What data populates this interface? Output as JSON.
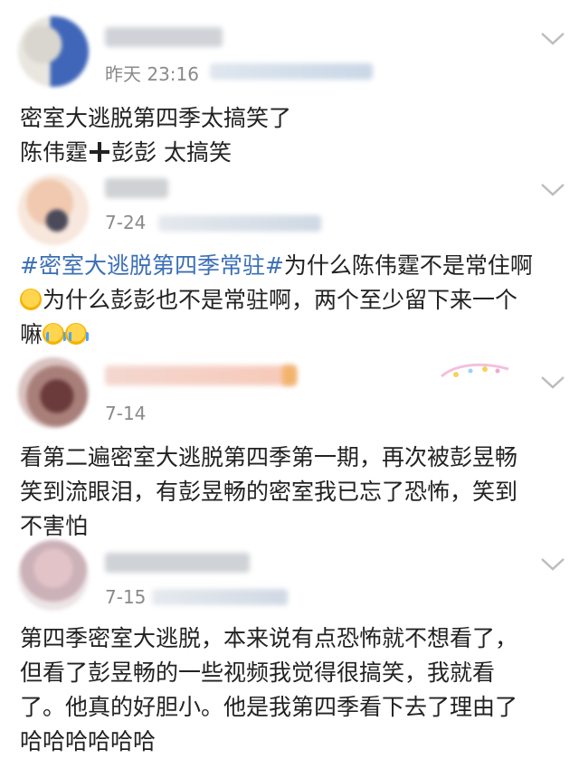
{
  "posts": [
    {
      "time": "昨天 23:16",
      "lines": [
        "密室大逃脱第四季太搞笑了"
      ],
      "line2_left": "陈伟霆",
      "line2_right": "彭彭 太搞笑"
    },
    {
      "time": "7-24",
      "topic": "#密室大逃脱第四季常驻#",
      "text_after_topic": "为什么陈伟霆不是常住啊",
      "line2": "为什么彭彭也不是常驻啊，两个至少留下来一个",
      "line3": "嘛"
    },
    {
      "time": "7-14",
      "lines": [
        "看第二遍密室大逃脱第四季第一期，再次被彭昱畅",
        "笑到流眼泪，有彭昱畅的密室我已忘了恐怖，笑到",
        "不害怕"
      ]
    },
    {
      "time": "7-15",
      "lines": [
        "第四季密室大逃脱，本来说有点恐怖就不想看了，",
        "但看了彭昱畅的一些视频我觉得很搞笑，我就看",
        "了。他真的好胆小。他是我第四季看下去了理由了",
        "哈哈哈哈哈哈"
      ]
    }
  ],
  "icons": {
    "expand": "chevron-down-icon",
    "emoji_think": "thinking-face-icon",
    "emoji_cry": "crying-face-icon",
    "plus": "plus-icon"
  },
  "colors": {
    "topic": "#3b6fb5",
    "time": "#8a8a8a"
  }
}
